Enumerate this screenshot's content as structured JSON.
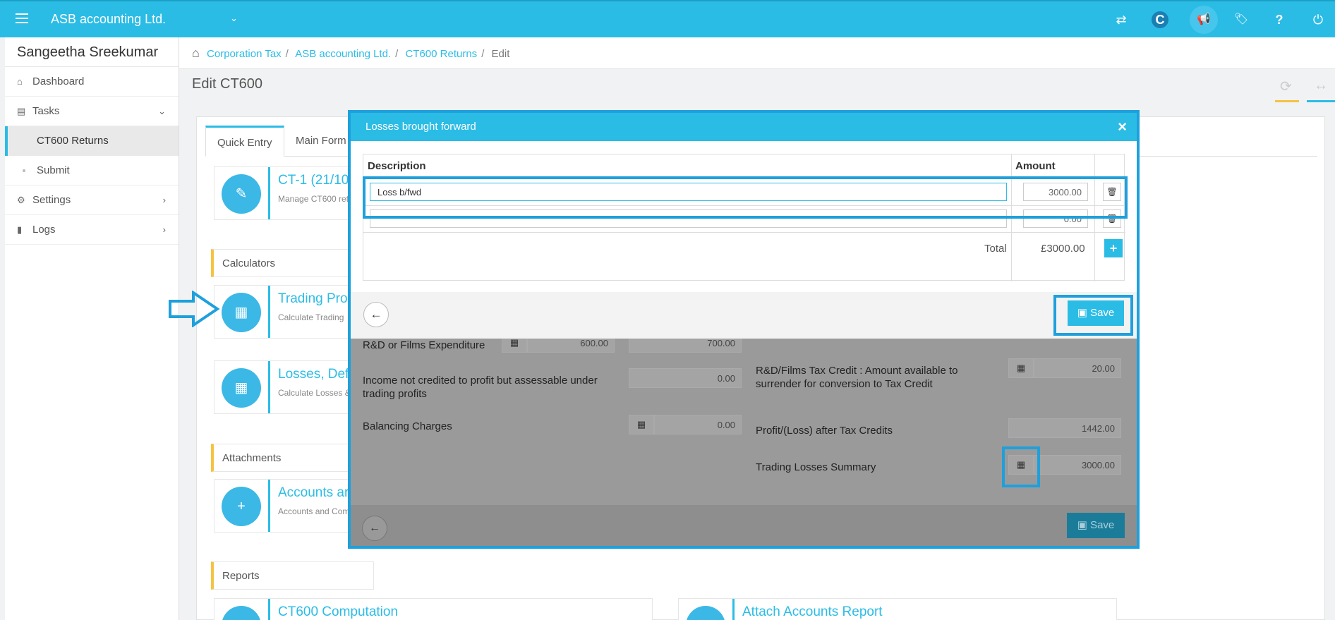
{
  "topbar": {
    "company": "ASB accounting Ltd.",
    "caret": "⌄",
    "icons": [
      "swap-icon",
      "c-logo-icon",
      "megaphone-icon",
      "ticket-icon",
      "help-icon",
      "power-icon"
    ],
    "icon_glyphs": [
      "⇄",
      "C",
      "📢",
      "🏷",
      "?",
      "⏻"
    ],
    "accent": "#2bbce6"
  },
  "sidebar": {
    "user": "Sangeetha Sreekumar",
    "items": [
      {
        "label": "Dashboard",
        "icon": "home-icon",
        "glyph": "⌂"
      },
      {
        "label": "Tasks",
        "icon": "tasks-icon",
        "glyph": "▤",
        "chev": "⌄"
      },
      {
        "label": "CT600 Returns"
      },
      {
        "label": "Submit"
      },
      {
        "label": "Settings",
        "icon": "gear-icon",
        "glyph": "⚙",
        "chev": "›"
      },
      {
        "label": "Logs",
        "icon": "file-icon",
        "glyph": "▮",
        "chev": "›"
      }
    ]
  },
  "breadcrumb": {
    "home_glyph": "⌂",
    "items": [
      "Corporation Tax",
      "ASB accounting Ltd.",
      "CT600 Returns"
    ],
    "current": "Edit",
    "sep": "/"
  },
  "page": {
    "title": "Edit CT600"
  },
  "tabs": [
    "Quick Entry",
    "Main Form"
  ],
  "cards": {
    "ct1": {
      "title": "CT-1 (21/10",
      "sub": "Manage CT600 ret"
    },
    "trading": {
      "title": "Trading Prof",
      "sub": "Calculate Trading"
    },
    "losses": {
      "title": "Losses, Def",
      "sub": "Calculate Losses &"
    },
    "accounts": {
      "title": "Accounts ar",
      "sub": "Accounts and Com"
    },
    "ct600comp": {
      "title": "CT600 Computation"
    },
    "attach": {
      "title": "Attach Accounts Report"
    }
  },
  "sections": {
    "calculators": "Calculators",
    "attachments": "Attachments",
    "reports": "Reports"
  },
  "background_form": {
    "rd_label": "R&D or Films Expenditure",
    "rd_val1": "600.00",
    "rd_val2": "700.00",
    "income_label": "Income not credited to profit but assessable under trading profits",
    "income_val": "0.00",
    "balancing_label": "Balancing Charges",
    "balancing_val": "0.00",
    "rdcredit_label": "R&D/Films Tax Credit : Amount available to surrender for conversion to Tax Credit",
    "rdcredit_val": "20.00",
    "profit_label": "Profit/(Loss) after Tax Credits",
    "profit_val": "1442.00",
    "summary_label": "Trading Losses Summary",
    "summary_val": "3000.00",
    "save": "Save"
  },
  "modal": {
    "title": "Losses brought forward",
    "close": "×",
    "col_description": "Description",
    "col_amount": "Amount",
    "rows": [
      {
        "description": "Loss b/fwd",
        "amount": "3000.00"
      },
      {
        "description": "",
        "amount": "0.00"
      }
    ],
    "total_label": "Total",
    "total_value": "£3000.00",
    "add": "+",
    "save": "Save",
    "back_glyph": "←",
    "trash_glyph": "🗑"
  }
}
